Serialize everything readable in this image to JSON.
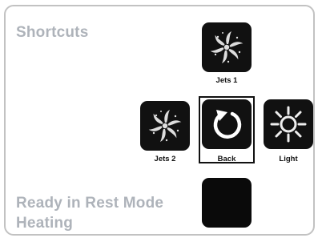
{
  "panel": {
    "title": "Shortcuts",
    "status_line1": "Ready in Rest Mode",
    "status_line2": "Heating"
  },
  "shortcuts": [
    {
      "label": "Jets 1",
      "icon": "jets-icon"
    },
    {
      "label": "Jets 2",
      "icon": "jets-icon"
    },
    {
      "label": "Back",
      "icon": "back-arrow-icon",
      "selected": true
    },
    {
      "label": "Light",
      "icon": "sun-icon"
    }
  ],
  "extra_tile": {
    "icon": "blank-tile"
  },
  "colors": {
    "heading": "#aeb3ba",
    "tile": "#111111",
    "border": "#c2c2c2"
  }
}
